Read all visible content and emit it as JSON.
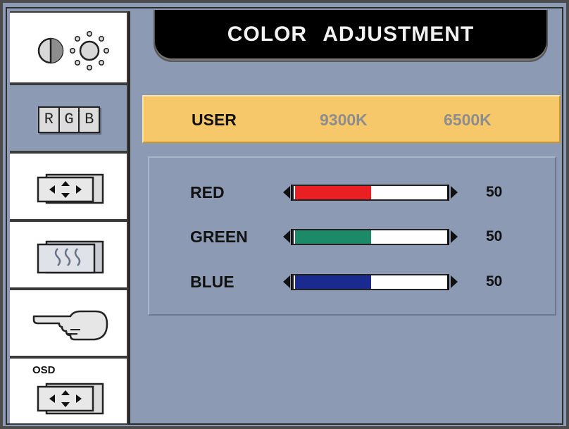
{
  "title": "COLOR ADJUSTMENT",
  "sidebar": {
    "items": [
      {
        "icon": "contrast-brightness-icon"
      },
      {
        "icon": "rgb-icon",
        "label": "RGB",
        "letters": [
          "R",
          "G",
          "B"
        ],
        "active": true
      },
      {
        "icon": "position-icon"
      },
      {
        "icon": "phase-icon"
      },
      {
        "icon": "hand-pointer-icon"
      },
      {
        "icon": "osd-position-icon",
        "label": "OSD"
      }
    ]
  },
  "presets": {
    "items": [
      {
        "label": "USER",
        "selected": true
      },
      {
        "label": "9300K",
        "selected": false
      },
      {
        "label": "6500K",
        "selected": false
      }
    ],
    "bar_color": "#f6c86a"
  },
  "sliders": [
    {
      "label": "RED",
      "value": "50",
      "level": 0.5,
      "color": "#ea1f23"
    },
    {
      "label": "GREEN",
      "value": "50",
      "level": 0.5,
      "color": "#1c8a68"
    },
    {
      "label": "BLUE",
      "value": "50",
      "level": 0.5,
      "color": "#1b2a8e"
    }
  ]
}
